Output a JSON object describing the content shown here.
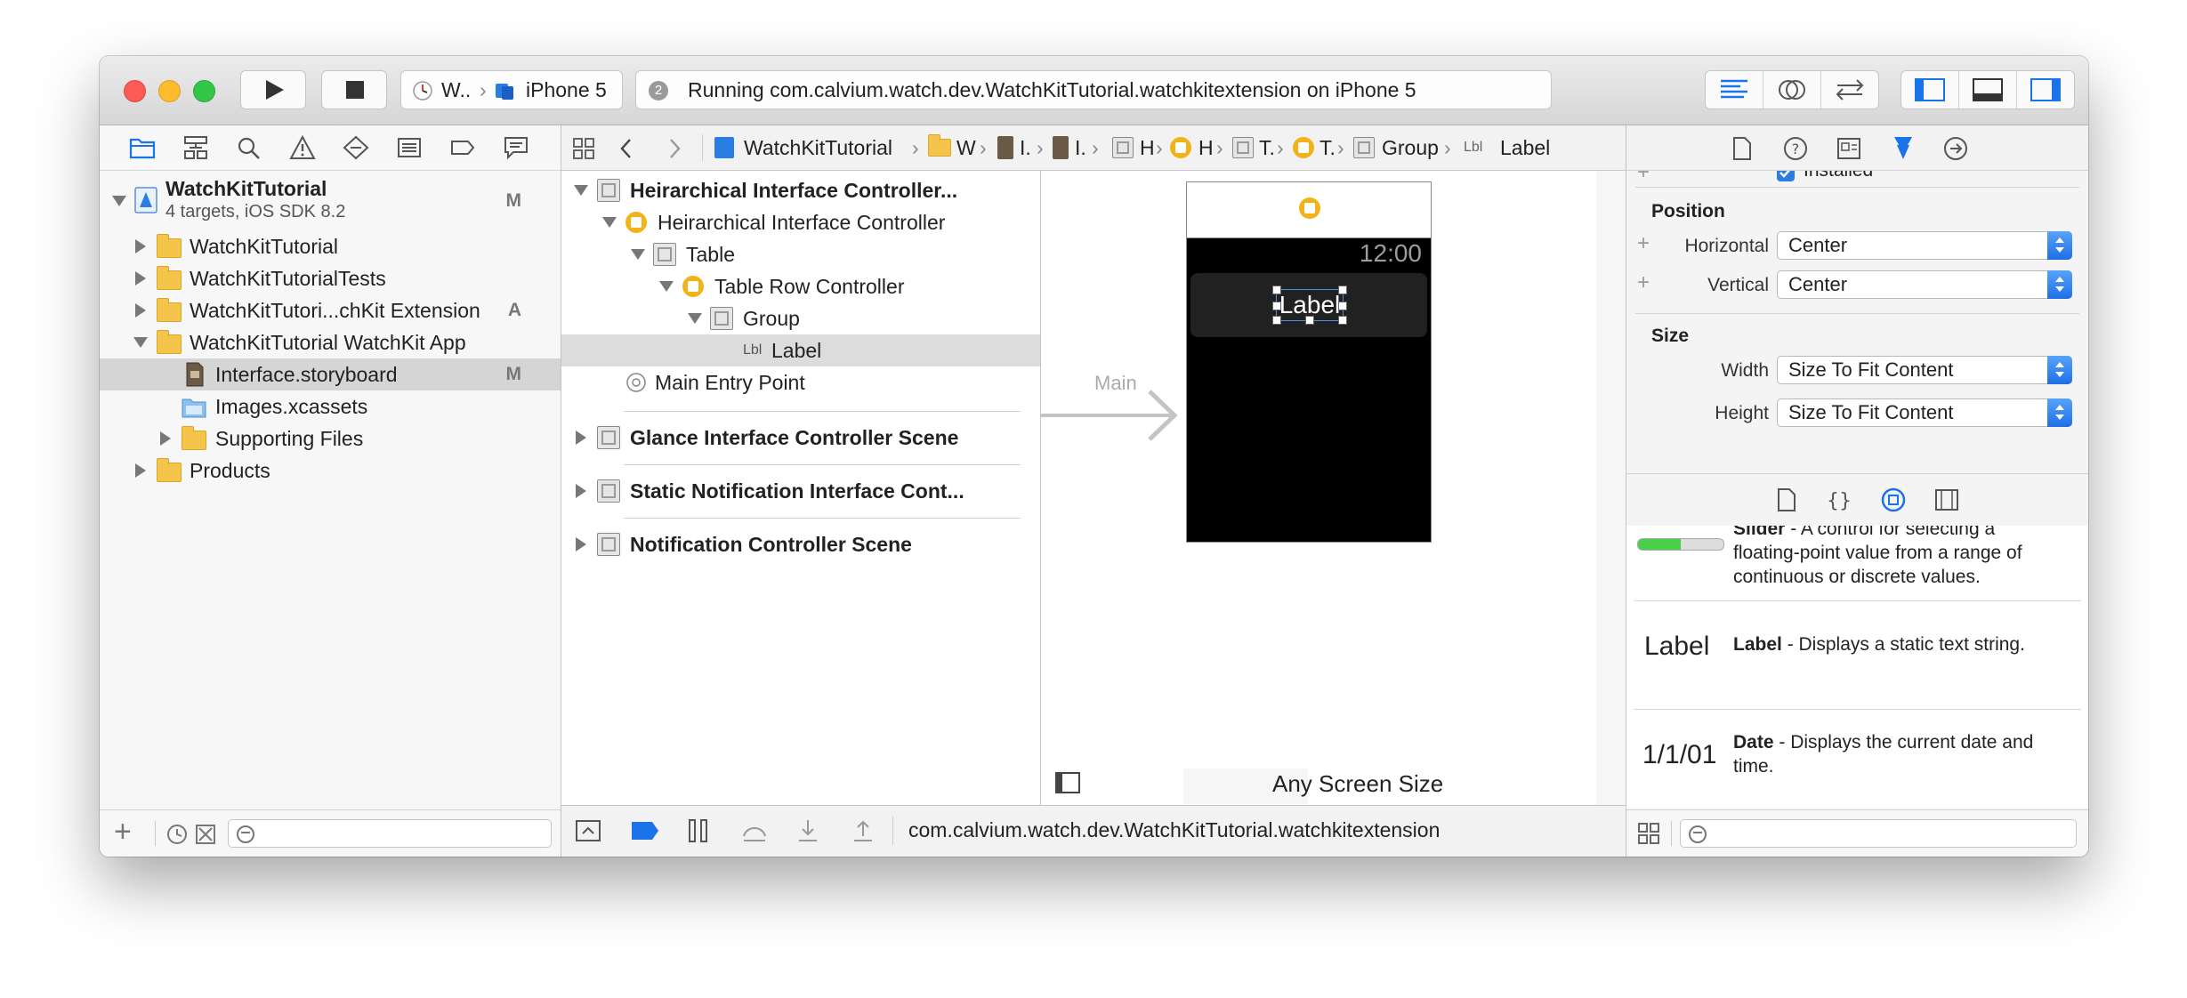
{
  "toolbar": {
    "scheme_target": "W..",
    "scheme_device": "iPhone 5",
    "activity_count": "2",
    "activity_status": "Running com.calvium.watch.dev.WatchKitTutorial.watchkitextension on iPhone 5"
  },
  "navigator": {
    "project_name": "WatchKitTutorial",
    "project_subtitle": "4 targets, iOS SDK 8.2",
    "project_badge": "M",
    "items": [
      {
        "label": "WatchKitTutorial",
        "badge": ""
      },
      {
        "label": "WatchKitTutorialTests",
        "badge": ""
      },
      {
        "label": "WatchKitTutori...chKit Extension",
        "badge": "A"
      },
      {
        "label": "WatchKitTutorial WatchKit App",
        "badge": ""
      },
      {
        "label": "Interface.storyboard",
        "badge": "M"
      },
      {
        "label": "Images.xcassets",
        "badge": ""
      },
      {
        "label": "Supporting Files",
        "badge": ""
      },
      {
        "label": "Products",
        "badge": ""
      }
    ]
  },
  "jumpbar": {
    "crumbs": [
      "WatchKitTutorial",
      "W",
      "I.",
      "I.",
      "H",
      "H",
      "T.",
      "T.",
      "Group",
      "Label"
    ],
    "lbl_tag": "Lbl"
  },
  "outline": {
    "scene1": "Heirarchical Interface Controller...",
    "controller": "Heirarchical Interface Controller",
    "table": "Table",
    "row_controller": "Table Row Controller",
    "group": "Group",
    "label_tag": "Lbl",
    "label": "Label",
    "entry_point": "Main Entry Point",
    "scene2": "Glance Interface Controller Scene",
    "scene3": "Static Notification Interface Cont...",
    "scene4": "Notification Controller Scene"
  },
  "canvas": {
    "arrow_label": "Main",
    "watch_time": "12:00",
    "watch_label": "Label",
    "size_class": "Any Screen Size"
  },
  "debugbar": {
    "target_path": "com.calvium.watch.dev.WatchKitTutorial.watchkitextension"
  },
  "inspector": {
    "installed_label": "Installed",
    "position_title": "Position",
    "horizontal_label": "Horizontal",
    "horizontal_value": "Center",
    "vertical_label": "Vertical",
    "vertical_value": "Center",
    "size_title": "Size",
    "width_label": "Width",
    "width_value": "Size To Fit Content",
    "height_label": "Height",
    "height_value": "Size To Fit Content"
  },
  "library": {
    "slider_title": "Slider",
    "slider_desc_line1": " - A control for selecting a",
    "slider_desc_line2": "floating-point value from a range of",
    "slider_desc_line3": "continuous or discrete values.",
    "label_preview": "Label",
    "label_title": "Label",
    "label_desc": " - Displays a static text string.",
    "date_preview": "1/1/01",
    "date_title": "Date",
    "date_desc_line1": " - Displays the current date and",
    "date_desc_line2": "time."
  },
  "colors": {
    "accent": "#1a73e8",
    "folder": "#f4c54a",
    "ring": "#f2b31a",
    "traffic_close": "#fc5b57",
    "traffic_min": "#fdbb2e",
    "traffic_max": "#33c748"
  }
}
